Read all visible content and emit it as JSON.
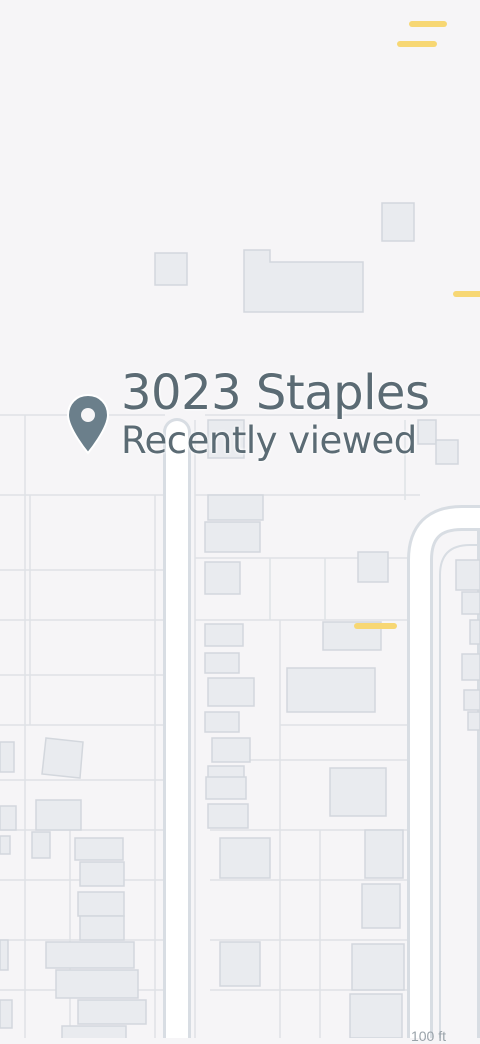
{
  "place": {
    "name": "3023 Staples",
    "status": "Recently viewed",
    "icon": "map-pin-icon"
  },
  "map": {
    "scale_label": "100 ft",
    "colors": {
      "background": "#f6f5f7",
      "road_fill": "#ffffff",
      "road_edge": "#d8dde3",
      "building": "#e9ebef",
      "building_edge": "#d3d7dd",
      "parcel_line": "#dfe2e6",
      "poi_marker": "#f7d774",
      "pin": "#6b7f8b"
    }
  }
}
